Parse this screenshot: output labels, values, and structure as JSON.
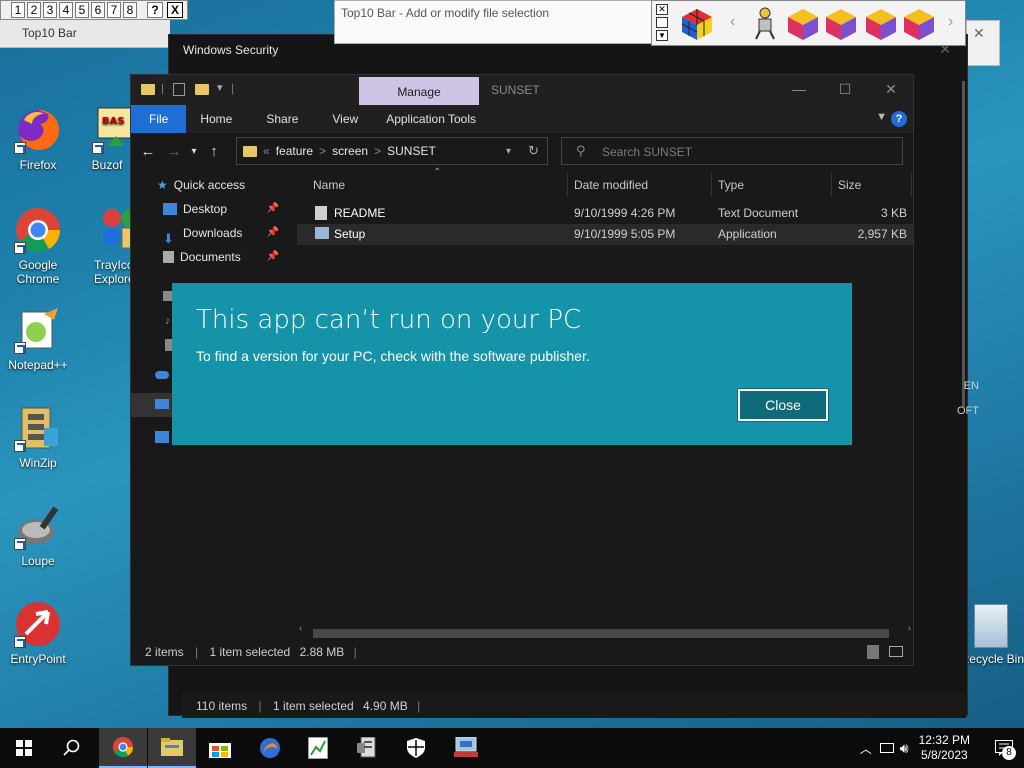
{
  "top10_bar": {
    "numbers": [
      "1",
      "2",
      "3",
      "4",
      "5",
      "6",
      "7",
      "8"
    ],
    "help_label": "?",
    "close_label": "X",
    "title": "Top10 Bar"
  },
  "top10_editor": {
    "title": "Top10 Bar - Add or modify file selection"
  },
  "windows_security": {
    "title": "Windows Security",
    "status": {
      "items_count": "110 items",
      "selected": "1 item selected",
      "size": "4.90 MB"
    },
    "bg_labels": [
      "EN",
      "OFT"
    ]
  },
  "desktop_icons": [
    {
      "label": "Firefox",
      "icon": "firefox-icon"
    },
    {
      "label": "Buzof",
      "icon": "buzof-icon"
    },
    {
      "label": "Google Chrome",
      "icon": "chrome-icon"
    },
    {
      "label": "TrayIcon Explorer",
      "icon": "trayicon-explorer-icon"
    },
    {
      "label": "Notepad++",
      "icon": "notepadpp-icon"
    },
    {
      "label": "WinZip",
      "icon": "winzip-icon"
    },
    {
      "label": "Loupe",
      "icon": "loupe-icon"
    },
    {
      "label": "EntryPoint",
      "icon": "entrypoint-icon"
    },
    {
      "label": "Recycle Bin",
      "icon": "recycle-bin-icon"
    }
  ],
  "explorer": {
    "manage_tab": "Manage",
    "window_title": "SUNSET",
    "ribbon_tabs": [
      "File",
      "Home",
      "Share",
      "View",
      "Application Tools"
    ],
    "help": "?",
    "breadcrumb": [
      "feature",
      "screen",
      "SUNSET"
    ],
    "breadcrumb_sep": ">",
    "search_placeholder": "Search SUNSET",
    "nav": {
      "quick_access": "Quick access",
      "items": [
        "Desktop",
        "Downloads",
        "Documents"
      ]
    },
    "columns": [
      "Name",
      "Date modified",
      "Type",
      "Size"
    ],
    "files": [
      {
        "name": "README",
        "date": "9/10/1999 4:26 PM",
        "type": "Text Document",
        "size": "3 KB",
        "selected": false
      },
      {
        "name": "Setup",
        "date": "9/10/1999 5:05 PM",
        "type": "Application",
        "size": "2,957 KB",
        "selected": true
      }
    ],
    "status": {
      "items_count": "2 items",
      "selected": "1 item selected",
      "size": "2.88 MB"
    }
  },
  "dialog": {
    "title": "This app can’t run on your PC",
    "message": "To find a version for your PC, check with the software publisher.",
    "close_label": "Close"
  },
  "taskbar": {
    "items": [
      "start-icon",
      "search-icon",
      "chrome-icon",
      "file-explorer-icon",
      "store-icon",
      "app-icon",
      "chart-icon",
      "document-icon",
      "security-shield-icon",
      "monitor-icon"
    ],
    "time": "12:32 PM",
    "date": "5/8/2023",
    "notification_count": "8"
  },
  "colors": {
    "dialog_bg": "#1594a9",
    "accent_blue": "#1f6ed4",
    "manage_tab": "#cfc4e6",
    "dark_bg": "#191919"
  }
}
